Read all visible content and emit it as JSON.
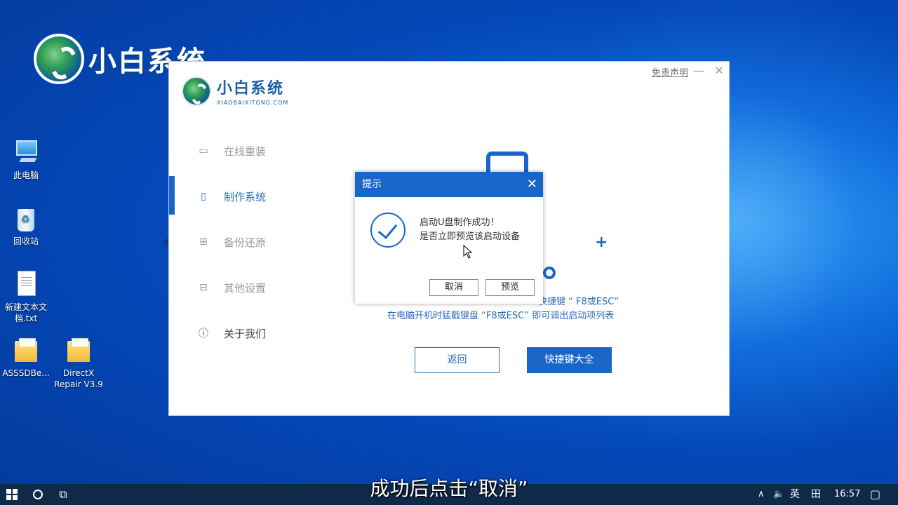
{
  "watermark": {
    "text": "小白系统"
  },
  "desktop": {
    "icons": [
      {
        "name": "this-pc",
        "label": "此电脑"
      },
      {
        "name": "recycle-bin",
        "label": "回收站"
      },
      {
        "name": "new-text-doc",
        "label": "新建文本文档.txt"
      },
      {
        "name": "asssd",
        "label": "ASSSDBe..."
      },
      {
        "name": "directx-repair",
        "label": "DirectX Repair V3.9"
      }
    ]
  },
  "app": {
    "logo_title": "小白系统",
    "logo_subtitle": "XIAOBAIXITONG.COM",
    "disclaimer": "免责声明",
    "minimize_glyph": "—",
    "close_glyph": "✕",
    "sidebar": {
      "items": [
        {
          "label": "在线重装",
          "icon": "monitor-icon"
        },
        {
          "label": "制作系统",
          "icon": "usb-icon"
        },
        {
          "label": "备份还原",
          "icon": "grid-icon"
        },
        {
          "label": "其他设置",
          "icon": "briefcase-icon"
        },
        {
          "label": "关于我们",
          "icon": "info-icon"
        }
      ],
      "active_index": 1
    },
    "hint_line1": "快捷键 “ F8或ESC”",
    "hint_line2": "在电脑开机时猛戳键盘 “F8或ESC” 即可调出启动项列表",
    "back_button": "返回",
    "hotkey_button": "快捷键大全",
    "stray_char": "小"
  },
  "dialog": {
    "title": "提示",
    "close_glyph": "✕",
    "message_line1": "启动U盘制作成功！",
    "message_line2": "是否立即预览该启动设备",
    "cancel": "取消",
    "preview": "预览"
  },
  "subtitle": "成功后点击“取消”",
  "taskbar": {
    "tray": {
      "chevron": "∧",
      "volume": "🔈",
      "ime": "英",
      "ime_mode": "田",
      "time": "16:57",
      "notification": "▢"
    }
  },
  "colors": {
    "accent": "#1a66c8",
    "link_blue": "#2c6bb8",
    "taskbar": "#0f2a48"
  }
}
